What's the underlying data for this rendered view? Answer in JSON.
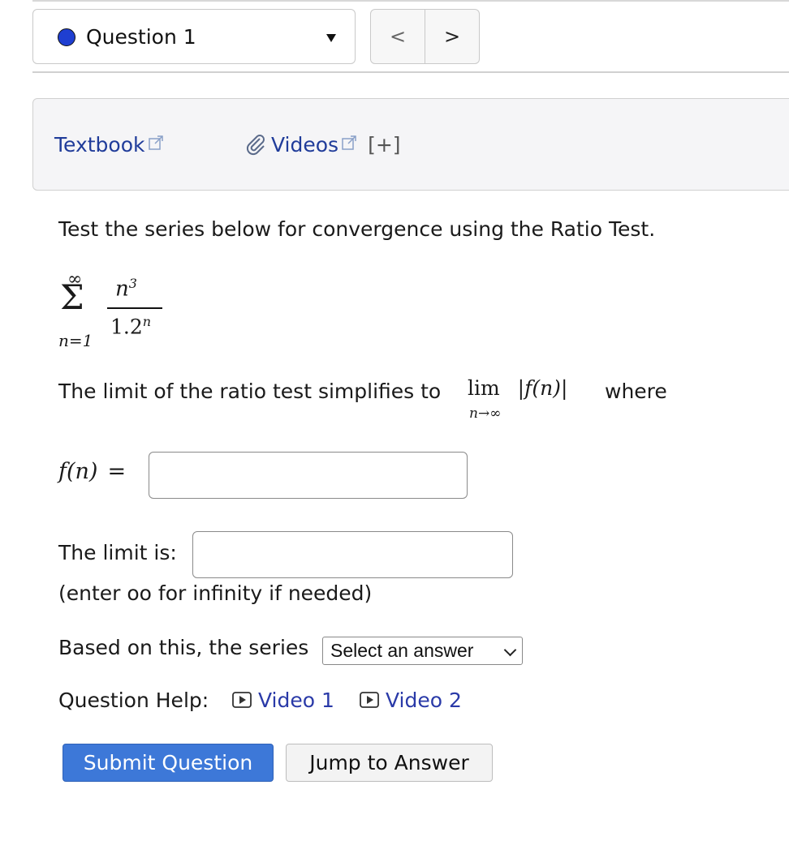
{
  "question_nav": {
    "current_label": "Question 1",
    "status_color": "#1f3fd1",
    "prev_glyph": "<",
    "next_glyph": ">"
  },
  "resources": {
    "textbook_label": "Textbook",
    "videos_label": "Videos",
    "expand_label": "[+]",
    "link_color": "#203c9a"
  },
  "problem": {
    "prompt": "Test the series below for convergence using the Ratio Test.",
    "series": {
      "upper": "∞",
      "lower": "n=1",
      "numerator_base": "n",
      "numerator_exp": "3",
      "denominator_base": "1.2",
      "denominator_exp": "n"
    },
    "limit_sentence": "The limit of the ratio test simplifies to",
    "limit_op": "lim",
    "limit_sub": "n→∞",
    "limit_expr": "|f(n)|",
    "limit_suffix": "where",
    "fn_label": "f(n)",
    "fn_equals": "=",
    "fn_value": "",
    "limit_label": "The limit is:",
    "limit_value": "",
    "infinity_note": "(enter oo for infinity if needed)",
    "based_label": "Based on this, the series",
    "answer_selected": "Select an answer"
  },
  "help": {
    "label": "Question Help:",
    "video1_label": "Video 1",
    "video2_label": "Video 2"
  },
  "actions": {
    "submit_label": "Submit Question",
    "submit_color": "#3d78d8",
    "jump_label": "Jump to Answer"
  }
}
